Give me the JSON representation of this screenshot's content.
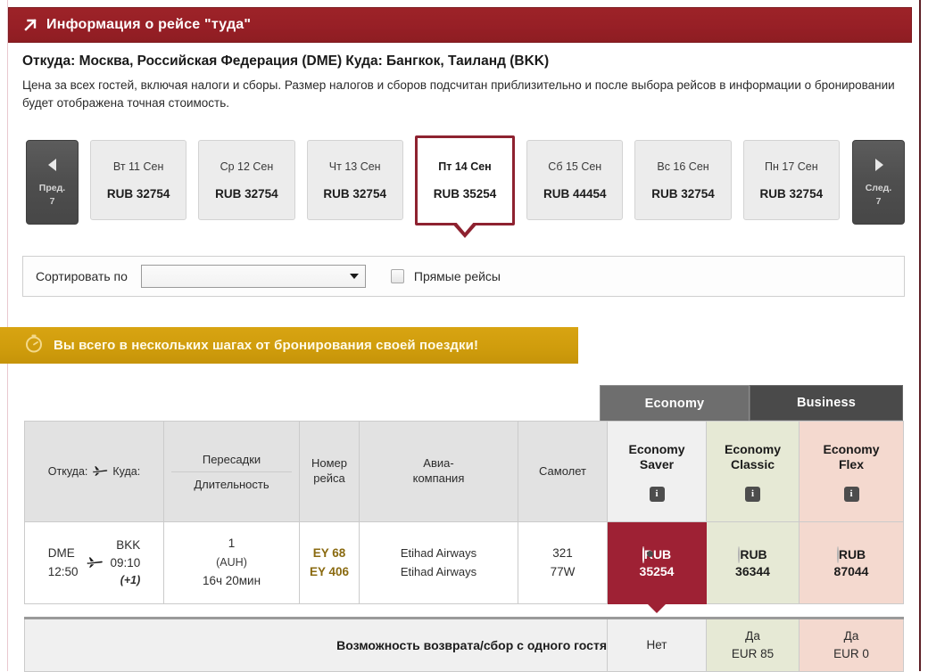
{
  "header": {
    "icon": "arrow-northeast-icon",
    "title": "Информация о рейсе \"туда\""
  },
  "intro": {
    "route": "Откуда: Москва, Российская Федерация (DME) Куда: Бангкок, Таиланд (BKK)",
    "note": "Цена за всех гостей, включая налоги и сборы. Размер налогов и сборов подсчитан приблизительно и после выбора рейсов в информации о бронировании будет отображена точная стоимость."
  },
  "date_strip": {
    "prev": {
      "label": "Пред.",
      "count": "7",
      "icon": "triangle-left-icon"
    },
    "next": {
      "label": "След.",
      "count": "7",
      "icon": "triangle-right-icon"
    },
    "days": [
      {
        "label": "Вт 11 Сен",
        "price": "RUB 32754",
        "selected": false
      },
      {
        "label": "Ср 12 Сен",
        "price": "RUB 32754",
        "selected": false
      },
      {
        "label": "Чт 13 Сен",
        "price": "RUB 32754",
        "selected": false
      },
      {
        "label": "Пт 14 Сен",
        "price": "RUB 35254",
        "selected": true
      },
      {
        "label": "Сб 15 Сен",
        "price": "RUB 44454",
        "selected": false
      },
      {
        "label": "Вс 16 Сен",
        "price": "RUB 32754",
        "selected": false
      },
      {
        "label": "Пн 17 Сен",
        "price": "RUB 32754",
        "selected": false
      }
    ]
  },
  "sort_bar": {
    "label": "Сортировать по",
    "select_value": "",
    "select_placeholder": "",
    "checkbox_label": "Прямые рейсы",
    "checkbox_checked": false
  },
  "banner": {
    "icon": "stopwatch-icon",
    "text": "Вы всего в нескольких шагах от бронирования своей поездки!"
  },
  "cabin_tabs": [
    {
      "label": "Economy",
      "active": true
    },
    {
      "label": "Business",
      "active": false
    }
  ],
  "table": {
    "headers": {
      "origin": "Откуда:",
      "plane_icon": "airplane-icon",
      "destination": "Куда:",
      "stops": "Пересадки",
      "duration": "Длительность",
      "flight_no_line1": "Номер",
      "flight_no_line2": "рейса",
      "airline_line1": "Авиа-",
      "airline_line2": "компания",
      "aircraft": "Самолет"
    },
    "fares": [
      {
        "name_line1": "Economy",
        "name_line2": "Saver",
        "info_icon": "info-icon",
        "color": "#f0f0f0"
      },
      {
        "name_line1": "Economy",
        "name_line2": "Classic",
        "info_icon": "info-icon",
        "color": "#e6e9d5"
      },
      {
        "name_line1": "Economy",
        "name_line2": "Flex",
        "info_icon": "info-icon",
        "color": "#f4d9cf"
      }
    ],
    "row": {
      "origin_code": "DME",
      "origin_time": "12:50",
      "dest_code": "BKK",
      "dest_time": "09:10",
      "dest_day_offset": "(+1)",
      "stops_count": "1",
      "stops_airport": "(AUH)",
      "duration": "16ч 20мин",
      "flight_no_1": "EY 68",
      "flight_no_2": "EY 406",
      "airline_1": "Etihad Airways",
      "airline_2": "Etihad Airways",
      "aircraft_1": "321",
      "aircraft_2": "77W",
      "prices": [
        {
          "currency": "RUB",
          "amount": "35254",
          "selected": true
        },
        {
          "currency": "RUB",
          "amount": "36344",
          "selected": false
        },
        {
          "currency": "RUB",
          "amount": "87044",
          "selected": false
        }
      ]
    }
  },
  "refund": {
    "label": "Возможность возврата/сбор с одного гостя",
    "values": [
      {
        "yes_no": "Нет",
        "fee": ""
      },
      {
        "yes_no": "Да",
        "fee": "EUR 85"
      },
      {
        "yes_no": "Да",
        "fee": "EUR 0"
      }
    ]
  },
  "colors": {
    "header_red": "#971f26",
    "selected_fare_red": "#9e2134",
    "selected_day_border": "#8e2230",
    "banner_yellow": "#cf9c0c",
    "tab_active_gray": "#6e6e6e",
    "tab_inactive_gray": "#4a4a4a",
    "flight_number_gold": "#8a6a10"
  }
}
